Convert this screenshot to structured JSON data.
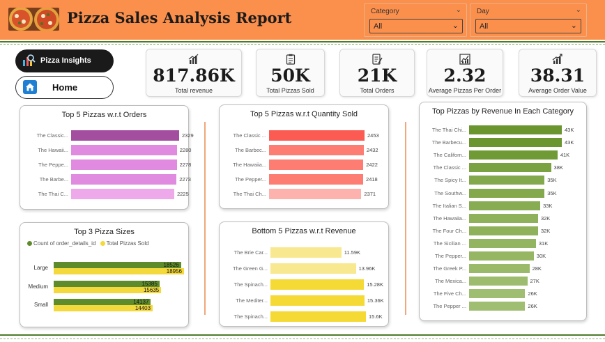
{
  "header": {
    "title": "Pizza Sales Analysis Report",
    "slicers": [
      {
        "label": "Category",
        "value": "All"
      },
      {
        "label": "Day",
        "value": "All"
      }
    ]
  },
  "nav": {
    "insights_label": "Pizza Insights",
    "home_label": "Home"
  },
  "kpis": [
    {
      "value": "817.86K",
      "label": "Total revenue",
      "icon": "bar-chart-icon"
    },
    {
      "value": "50K",
      "label": "Total Pizzas Sold",
      "icon": "clipboard-icon"
    },
    {
      "value": "21K",
      "label": "Total Orders",
      "icon": "checklist-icon"
    },
    {
      "value": "2.32",
      "label": "Average Pizzas Per Order",
      "icon": "line-chart-icon"
    },
    {
      "value": "38.31",
      "label": "Average Order Value",
      "icon": "growth-chart-icon"
    }
  ],
  "colors": {
    "header": "#fb8f4c",
    "green_rule": "#4e7a2a",
    "divider": "#f0a77b"
  },
  "chart_data": [
    {
      "id": "orders",
      "type": "bar",
      "title": "Top 5 Pizzas w.r.t Orders",
      "categories": [
        "The Classic...",
        "The Hawaii...",
        "The Peppe...",
        "The Barbe...",
        "The Thai C..."
      ],
      "values": [
        2329,
        2280,
        2278,
        2273,
        2225
      ],
      "value_labels": [
        "2329",
        "2280",
        "2278",
        "2273",
        "2225"
      ],
      "colors": [
        "#a44ea0",
        "#e08be0",
        "#e08be0",
        "#e08be0",
        "#eda9ea"
      ]
    },
    {
      "id": "quantity",
      "type": "bar",
      "title": "Top 5 Pizzas w.r.t Quantity Sold",
      "categories": [
        "The Classic ...",
        "The Barbec...",
        "The Hawaiia...",
        "The Pepper...",
        "The Thai Ch..."
      ],
      "values": [
        2453,
        2432,
        2422,
        2418,
        2371
      ],
      "value_labels": [
        "2453",
        "2432",
        "2422",
        "2418",
        "2371"
      ],
      "colors": [
        "#fb5b52",
        "#fd7d73",
        "#fd7d73",
        "#fd7d73",
        "#feb2ae"
      ]
    },
    {
      "id": "sizes",
      "type": "bar",
      "title": "Top 3 Pizza Sizes",
      "categories": [
        "Large",
        "Medium",
        "Small"
      ],
      "series": [
        {
          "name": "Count of order_details_id",
          "values": [
            18526,
            15385,
            14137
          ],
          "color": "#5e8c2c"
        },
        {
          "name": "Total Pizzas Sold",
          "values": [
            18956,
            15635,
            14403
          ],
          "color": "#f4d93c"
        }
      ]
    },
    {
      "id": "bottom",
      "type": "bar",
      "title": "Bottom 5 Pizzas w.r.t Revenue",
      "categories": [
        "The Brie Car...",
        "The Green G...",
        "The Spinach...",
        "The Mediter...",
        "The Spinach..."
      ],
      "values": [
        11.59,
        13.96,
        15.28,
        15.36,
        15.6
      ],
      "value_labels": [
        "11.59K",
        "13.96K",
        "15.28K",
        "15.36K",
        "15.6K"
      ],
      "colors": [
        "#f8e990",
        "#f8e990",
        "#f5d935",
        "#f5d935",
        "#f5d935"
      ]
    },
    {
      "id": "category",
      "type": "bar",
      "title": "Top Pizzas by Revenue In Each Category",
      "categories": [
        "The Thai Chi...",
        "The Barbecu...",
        "The Californ...",
        "The Classic ...",
        "The Spicy It...",
        "The Southw...",
        "The Italian S...",
        "The Hawaiia...",
        "The Four Ch...",
        "The Sicilian ...",
        "The Pepper...",
        "The Greek P...",
        "The Mexica...",
        "The Five Ch...",
        "The Pepper ..."
      ],
      "values": [
        43,
        43,
        41,
        38,
        35,
        35,
        33,
        32,
        32,
        31,
        30,
        28,
        27,
        26,
        26
      ],
      "value_labels": [
        "43K",
        "43K",
        "41K",
        "38K",
        "35K",
        "35K",
        "33K",
        "32K",
        "32K",
        "31K",
        "30K",
        "28K",
        "27K",
        "26K",
        "26K"
      ],
      "colors": [
        "#6a952f",
        "#6a952f",
        "#6f9a35",
        "#7aa240",
        "#84a94c",
        "#84a94c",
        "#88ac52",
        "#8fb15a",
        "#8fb15a",
        "#93b460",
        "#96b664",
        "#9aba6a",
        "#9dbc6d",
        "#a0be71",
        "#a0be71"
      ]
    }
  ]
}
